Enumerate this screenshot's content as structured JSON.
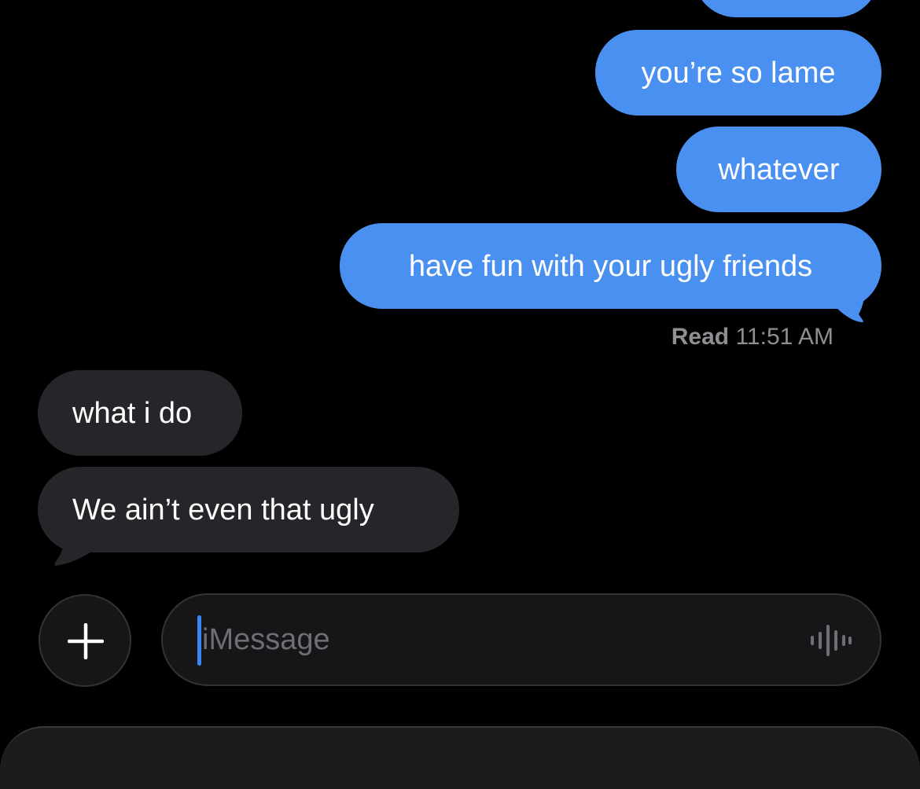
{
  "conversation": {
    "sent_messages": [
      {
        "text": "you’re so lame"
      },
      {
        "text": "whatever"
      },
      {
        "text": "have fun with your ugly friends"
      }
    ],
    "read_receipt": {
      "label": "Read",
      "time": "11:51 AM"
    },
    "received_messages": [
      {
        "text": "what i do"
      },
      {
        "text": "We ain’t even that ugly"
      }
    ]
  },
  "composer": {
    "placeholder": "iMessage",
    "plus_icon": "plus-icon",
    "voice_icon": "waveform-icon"
  },
  "colors": {
    "background": "#000000",
    "sent_bubble": "#4a90f0",
    "received_bubble": "#26262a",
    "caret": "#3a86f5",
    "secondary_text": "#8e8e93"
  }
}
